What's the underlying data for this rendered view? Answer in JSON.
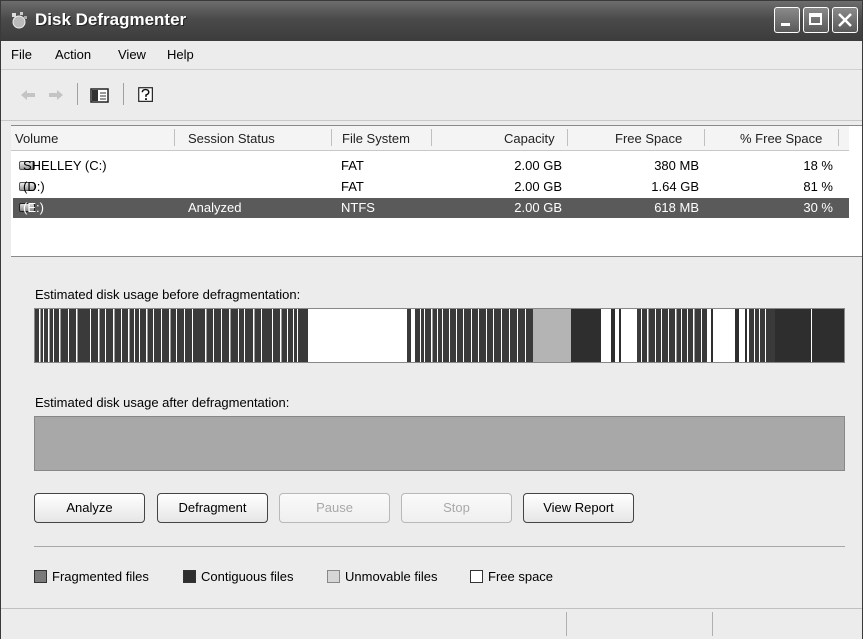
{
  "window": {
    "title": "Disk Defragmenter"
  },
  "menu": [
    "File",
    "Action",
    "View",
    "Help"
  ],
  "toolbar": {
    "icons": [
      "back-arrow-icon",
      "forward-arrow-icon",
      "show-hide-console-tree-icon",
      "help-icon"
    ]
  },
  "volumes": {
    "columns": [
      "Volume",
      "Session Status",
      "File System",
      "Capacity",
      "Free Space",
      "% Free Space"
    ],
    "rows": [
      {
        "volume": "SHELLEY (C:)",
        "status": "",
        "fs": "FAT",
        "capacity": "2.00 GB",
        "free": "380 MB",
        "pct": "18 %"
      },
      {
        "volume": "(D:)",
        "status": "",
        "fs": "FAT",
        "capacity": "2.00 GB",
        "free": "1.64 GB",
        "pct": "81 %"
      },
      {
        "volume": "(E:)",
        "status": "Analyzed",
        "fs": "NTFS",
        "capacity": "2.00 GB",
        "free": "618 MB",
        "pct": "30 %"
      }
    ],
    "selected_index": 2
  },
  "before_label": "Estimated disk usage before defragmentation:",
  "after_label": "Estimated disk usage after defragmentation:",
  "buttons": {
    "analyze": "Analyze",
    "defragment": "Defragment",
    "pause": "Pause",
    "stop": "Stop",
    "view_report": "View Report"
  },
  "legend": {
    "fragmented": "Fragmented files",
    "contiguous": "Contiguous files",
    "unmovable": "Unmovable files",
    "free": "Free space"
  },
  "colors": {
    "fragmented": "#7a7a7a",
    "contiguous": "#2e2e2e",
    "unmovable": "#b4b4b4",
    "free": "#ffffff",
    "selection": "#5a5a5a"
  }
}
